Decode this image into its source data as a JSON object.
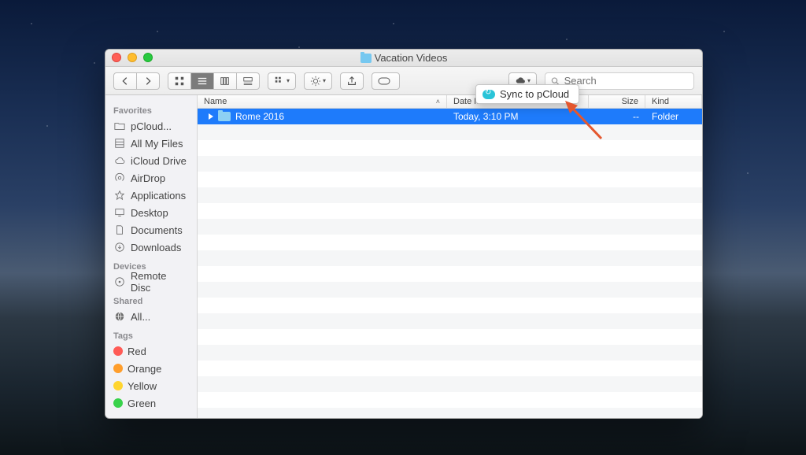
{
  "window": {
    "title": "Vacation Videos"
  },
  "toolbar": {
    "search_placeholder": "Search",
    "sync_menu_label": "Sync to pCloud"
  },
  "sidebar": {
    "sections": [
      {
        "header": "Favorites",
        "items": [
          {
            "label": "pCloud...",
            "icon": "folder"
          },
          {
            "label": "All My Files",
            "icon": "all-files"
          },
          {
            "label": "iCloud Drive",
            "icon": "icloud"
          },
          {
            "label": "AirDrop",
            "icon": "airdrop"
          },
          {
            "label": "Applications",
            "icon": "apps"
          },
          {
            "label": "Desktop",
            "icon": "desktop"
          },
          {
            "label": "Documents",
            "icon": "documents"
          },
          {
            "label": "Downloads",
            "icon": "downloads"
          }
        ]
      },
      {
        "header": "Devices",
        "items": [
          {
            "label": "Remote Disc",
            "icon": "disc"
          }
        ]
      },
      {
        "header": "Shared",
        "items": [
          {
            "label": "All...",
            "icon": "network"
          }
        ]
      },
      {
        "header": "Tags",
        "items": [
          {
            "label": "Red",
            "icon": "tag",
            "color": "#ff5b56"
          },
          {
            "label": "Orange",
            "icon": "tag",
            "color": "#ff9e2c"
          },
          {
            "label": "Yellow",
            "icon": "tag",
            "color": "#ffd52f"
          },
          {
            "label": "Green",
            "icon": "tag",
            "color": "#38d24b"
          }
        ]
      }
    ]
  },
  "columns": {
    "name": "Name",
    "date": "Date M",
    "size": "Size",
    "kind": "Kind"
  },
  "rows": [
    {
      "name": "Rome 2016",
      "date": "Today, 3:10 PM",
      "size": "--",
      "kind": "Folder",
      "selected": true
    }
  ]
}
